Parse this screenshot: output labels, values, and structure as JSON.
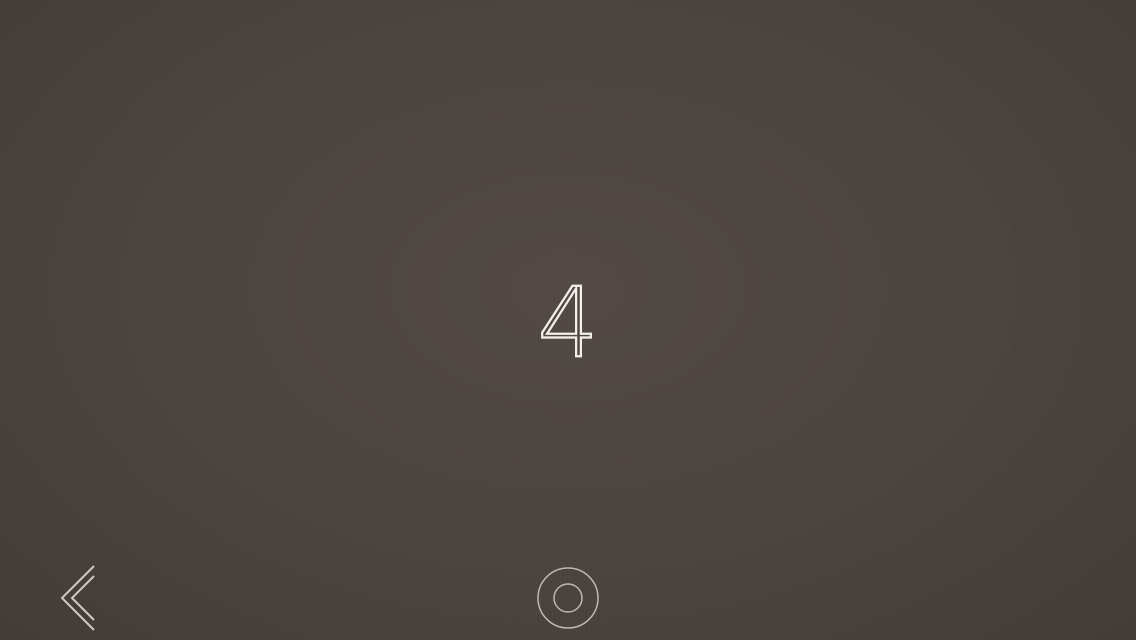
{
  "counter": {
    "value": "4"
  },
  "controls": {
    "back_icon": "double-chevron-left-icon",
    "home_icon": "concentric-circles-icon"
  },
  "colors": {
    "background": "#4b433f",
    "foreground": "#f2efed",
    "icon_stroke": "#cfc8c4"
  }
}
